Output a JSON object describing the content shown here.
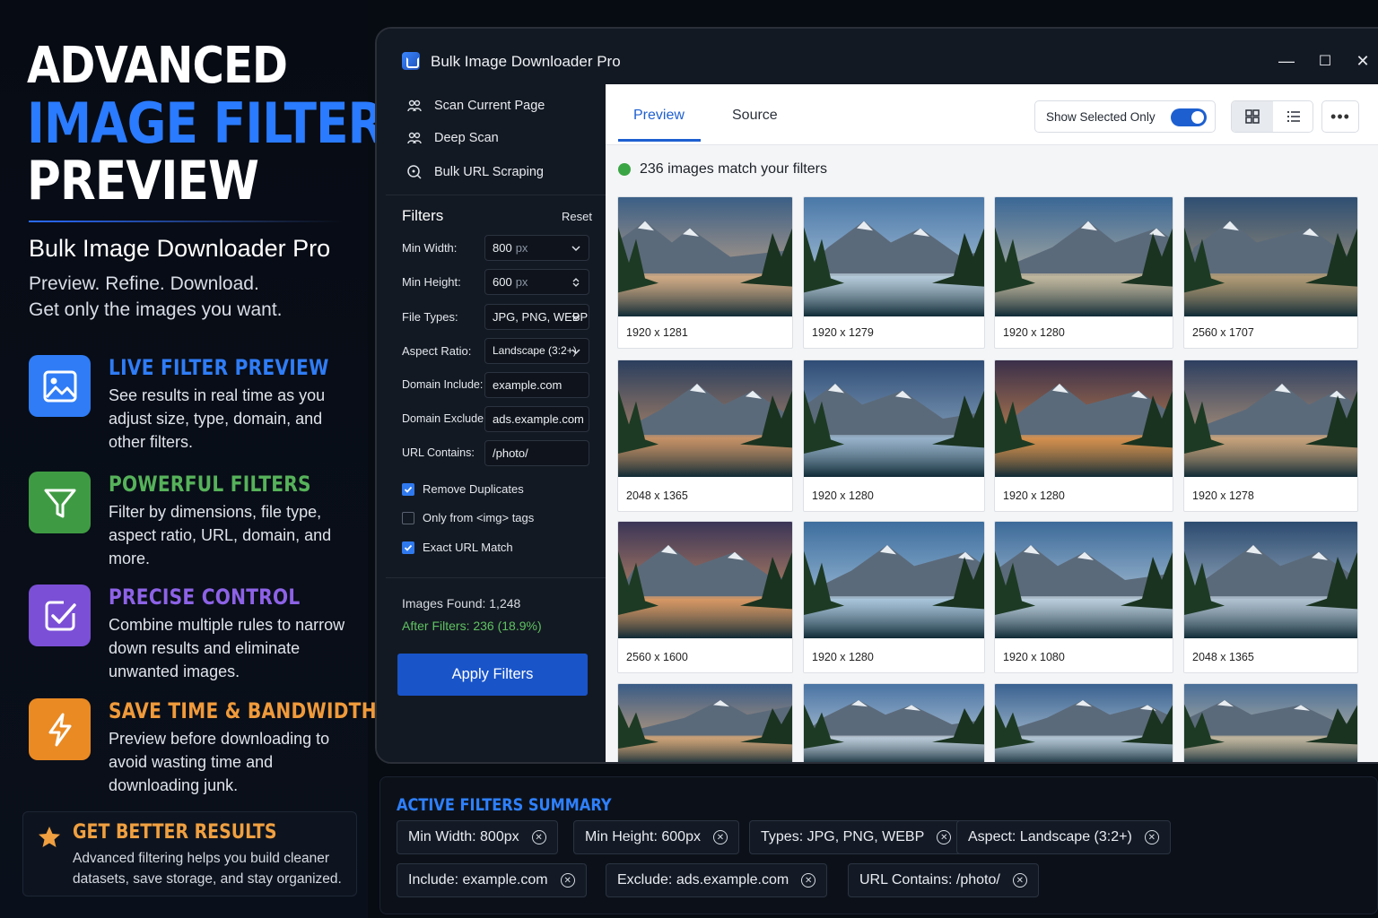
{
  "hero": {
    "line1": "ADVANCED",
    "line2": "IMAGE FILTER",
    "line3": "PREVIEW",
    "product": "Bulk Image Downloader Pro",
    "tagline1": "Preview. Refine. Download.",
    "tagline2": "Get only the images you want."
  },
  "features": [
    {
      "icon": "image-icon",
      "title": "LIVE FILTER PREVIEW",
      "color": "#2f7cf6",
      "desc": "See results in real time as you adjust size, type, domain, and other filters."
    },
    {
      "icon": "funnel-icon",
      "title": "POWERFUL FILTERS",
      "color": "#3f9b43",
      "desc": "Filter by dimensions, file type, aspect ratio, URL, domain, and more."
    },
    {
      "icon": "checkmark-icon",
      "title": "PRECISE CONTROL",
      "color": "#7b4fd6",
      "desc": "Combine multiple rules to narrow down results and eliminate unwanted images."
    },
    {
      "icon": "lightning-icon",
      "title": "SAVE TIME & BANDWIDTH",
      "color": "#ea8a23",
      "desc": "Preview before downloading to avoid wasting time and downloading junk."
    }
  ],
  "better": {
    "title": "GET BETTER RESULTS",
    "desc": "Advanced filtering helps you build cleaner datasets, save storage, and stay organized."
  },
  "window": {
    "title": "Bulk Image Downloader Pro",
    "controls": [
      "—",
      "☐",
      "✕"
    ]
  },
  "sidebar": {
    "scan_items": [
      "Scan Current Page",
      "Deep Scan",
      "Bulk URL Scraping"
    ],
    "filters_heading": "Filters",
    "reset": "Reset",
    "min_width": {
      "label": "Min Width:",
      "value": "800",
      "unit": "px"
    },
    "min_height": {
      "label": "Min Height:",
      "value": "600",
      "unit": "px"
    },
    "file_types": {
      "label": "File Types:",
      "value": "JPG, PNG, WEBP"
    },
    "aspect_ratio": {
      "label": "Aspect Ratio:",
      "value": "Landscape (3:2+)"
    },
    "domain_include": {
      "label": "Domain Include:",
      "value": "example.com"
    },
    "domain_exclude": {
      "label": "Domain Exclude:",
      "value": "ads.example.com"
    },
    "url_contains": {
      "label": "URL Contains:",
      "value": "/photo/"
    },
    "checkboxes": [
      {
        "label": "Remove Duplicates",
        "checked": true
      },
      {
        "label": "Only from <img> tags",
        "checked": false
      },
      {
        "label": "Exact URL Match",
        "checked": true
      }
    ],
    "images_found": "Images Found: 1,248",
    "after_filters": "After Filters: 236 (18.9%)",
    "apply": "Apply Filters"
  },
  "main": {
    "tabs": [
      "Preview",
      "Source"
    ],
    "show_selected": "Show Selected Only",
    "show_selected_on": true,
    "view_modes": [
      "grid-icon",
      "list-icon"
    ],
    "more": "•••",
    "match_text": "236 images match your filters"
  },
  "images": [
    "1920 x 1281",
    "1920 x 1279",
    "1920 x 1280",
    "2560 x 1707",
    "2048 x 1365",
    "1920 x 1280",
    "1920 x 1280",
    "1920 x 1278",
    "2560 x 1600",
    "1920 x 1280",
    "1920 x 1080",
    "2048 x 1365",
    "",
    "",
    "",
    ""
  ],
  "summary": {
    "heading": "ACTIVE FILTERS SUMMARY",
    "chips": [
      "Min Width: 800px",
      "Min Height: 600px",
      "Types: JPG, PNG, WEBP",
      "Aspect: Landscape (3:2+)",
      "Include: example.com",
      "Exclude: ads.example.com",
      "URL Contains: /photo/"
    ]
  }
}
